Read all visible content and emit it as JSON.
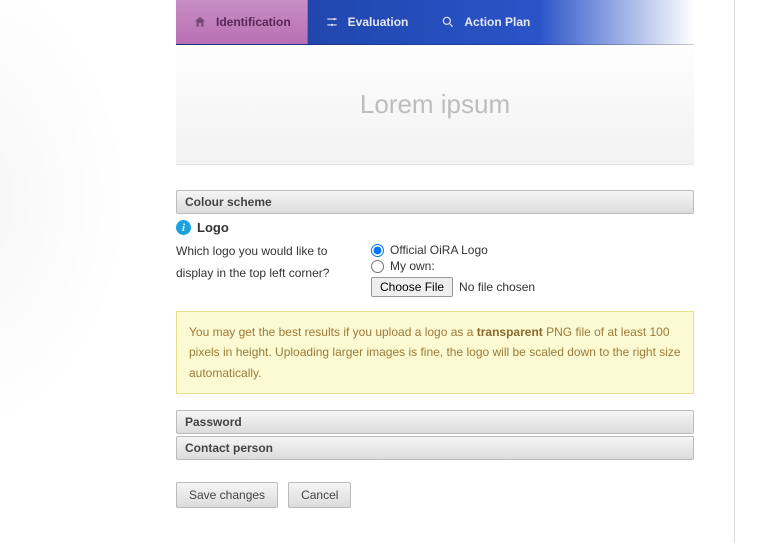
{
  "tabs": {
    "identification": "Identification",
    "evaluation": "Evaluation",
    "action_plan": "Action Plan"
  },
  "banner_text": "Lorem ipsum",
  "sections": {
    "colour_scheme": "Colour scheme",
    "password": "Password",
    "contact_person": "Contact person"
  },
  "logo": {
    "label": "Logo",
    "question": "Which logo you would like to display in the top left corner?",
    "option_official": "Official OiRA Logo",
    "option_own": "My own:",
    "choose_file": "Choose File",
    "no_file": "No file chosen"
  },
  "hint": {
    "pre": "You may get the best results if you upload a logo as a ",
    "bold": "transparent",
    "post": " PNG file of at least 100 pixels in height. Uploading larger images is fine, the logo will be scaled down to the right size automatically."
  },
  "buttons": {
    "save": "Save changes",
    "cancel": "Cancel"
  }
}
